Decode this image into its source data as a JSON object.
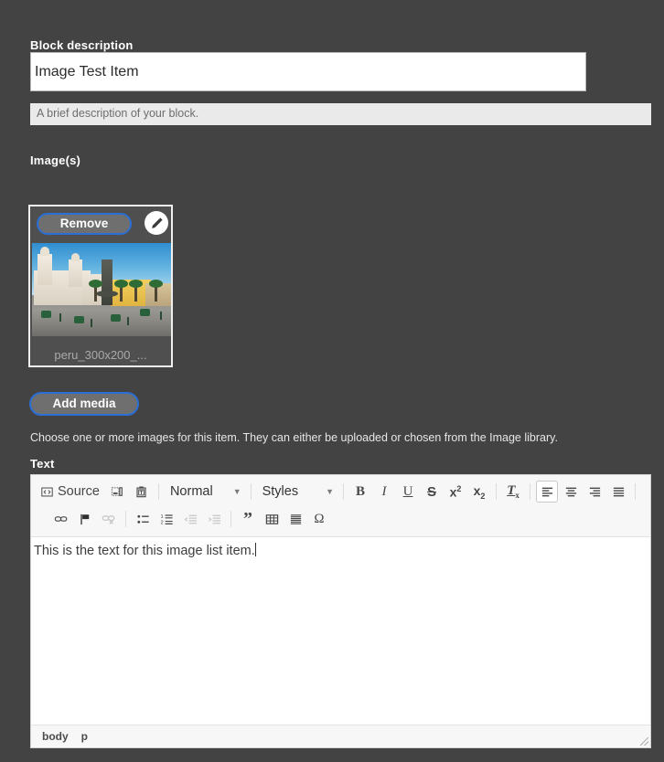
{
  "block_description": {
    "label": "Block description",
    "value": "Image Test Item",
    "help": "A brief description of your block."
  },
  "images": {
    "label": "Image(s)",
    "card": {
      "remove_label": "Remove",
      "edit_icon": "pencil-icon",
      "filename": "peru_300x200_...",
      "thumbnail_alt": "Plaza Mayor Lima Peru"
    },
    "add_media_label": "Add media",
    "help": "Choose one or more images for this item. They can either be uploaded or chosen from the Image library."
  },
  "text_field": {
    "label": "Text",
    "content": "This is the text for this image list item.",
    "toolbar": {
      "row1": [
        {
          "name": "source-button",
          "type": "text",
          "label": "Source",
          "icon": "source-code-icon",
          "state": "normal"
        },
        {
          "name": "paste-as-plain-text-button",
          "type": "icon",
          "icon": "paste-text-icon",
          "state": "normal"
        },
        {
          "name": "paste-from-word-button",
          "type": "icon",
          "icon": "paste-word-icon",
          "state": "normal"
        },
        {
          "name": "separator",
          "type": "sep"
        },
        {
          "name": "paragraph-format-combo",
          "type": "combo",
          "label": "Normal"
        },
        {
          "name": "separator",
          "type": "sep"
        },
        {
          "name": "styles-combo",
          "type": "combo",
          "label": "Styles"
        },
        {
          "name": "separator",
          "type": "sep"
        },
        {
          "name": "bold-button",
          "type": "icon",
          "icon": "bold-icon",
          "state": "normal"
        },
        {
          "name": "italic-button",
          "type": "icon",
          "icon": "italic-icon",
          "state": "normal"
        },
        {
          "name": "underline-button",
          "type": "icon",
          "icon": "underline-icon",
          "state": "normal"
        },
        {
          "name": "strikethrough-button",
          "type": "icon",
          "icon": "strikethrough-icon",
          "state": "normal"
        },
        {
          "name": "superscript-button",
          "type": "icon",
          "icon": "superscript-icon",
          "state": "normal"
        },
        {
          "name": "subscript-button",
          "type": "icon",
          "icon": "subscript-icon",
          "state": "normal"
        },
        {
          "name": "separator",
          "type": "sep"
        },
        {
          "name": "remove-format-button",
          "type": "icon",
          "icon": "remove-format-icon",
          "state": "normal"
        },
        {
          "name": "separator",
          "type": "sep"
        },
        {
          "name": "align-left-button",
          "type": "icon",
          "icon": "align-left-icon",
          "state": "active"
        },
        {
          "name": "align-center-button",
          "type": "icon",
          "icon": "align-center-icon",
          "state": "normal"
        },
        {
          "name": "align-right-button",
          "type": "icon",
          "icon": "align-right-icon",
          "state": "normal"
        },
        {
          "name": "align-justify-button",
          "type": "icon",
          "icon": "align-justify-icon",
          "state": "normal"
        },
        {
          "name": "separator",
          "type": "sep"
        }
      ],
      "row2": [
        {
          "name": "link-button",
          "type": "icon",
          "icon": "link-icon",
          "state": "normal"
        },
        {
          "name": "anchor-button",
          "type": "icon",
          "icon": "flag-anchor-icon",
          "state": "normal"
        },
        {
          "name": "unlink-button",
          "type": "icon",
          "icon": "unlink-icon",
          "state": "disabled"
        },
        {
          "name": "separator",
          "type": "sep"
        },
        {
          "name": "bulleted-list-button",
          "type": "icon",
          "icon": "bulleted-list-icon",
          "state": "normal"
        },
        {
          "name": "numbered-list-button",
          "type": "icon",
          "icon": "numbered-list-icon",
          "state": "normal"
        },
        {
          "name": "decrease-indent-button",
          "type": "icon",
          "icon": "outdent-icon",
          "state": "disabled"
        },
        {
          "name": "increase-indent-button",
          "type": "icon",
          "icon": "indent-icon",
          "state": "disabled"
        },
        {
          "name": "separator",
          "type": "sep"
        },
        {
          "name": "blockquote-button",
          "type": "icon",
          "icon": "quote-icon",
          "state": "normal"
        },
        {
          "name": "table-button",
          "type": "icon",
          "icon": "table-icon",
          "state": "normal"
        },
        {
          "name": "horizontal-rule-button",
          "type": "icon",
          "icon": "horizontal-rule-icon",
          "state": "normal"
        },
        {
          "name": "special-character-button",
          "type": "icon",
          "icon": "omega-icon",
          "state": "normal"
        }
      ]
    },
    "status_path": [
      "body",
      "p"
    ]
  },
  "colors": {
    "page_background": "#434343",
    "focus_ring": "#2b6fd4",
    "button_face": "#6f6f6f",
    "help_background": "#eaeaea",
    "toolbar_background": "#f7f7f7",
    "editor_background": "#ffffff"
  }
}
